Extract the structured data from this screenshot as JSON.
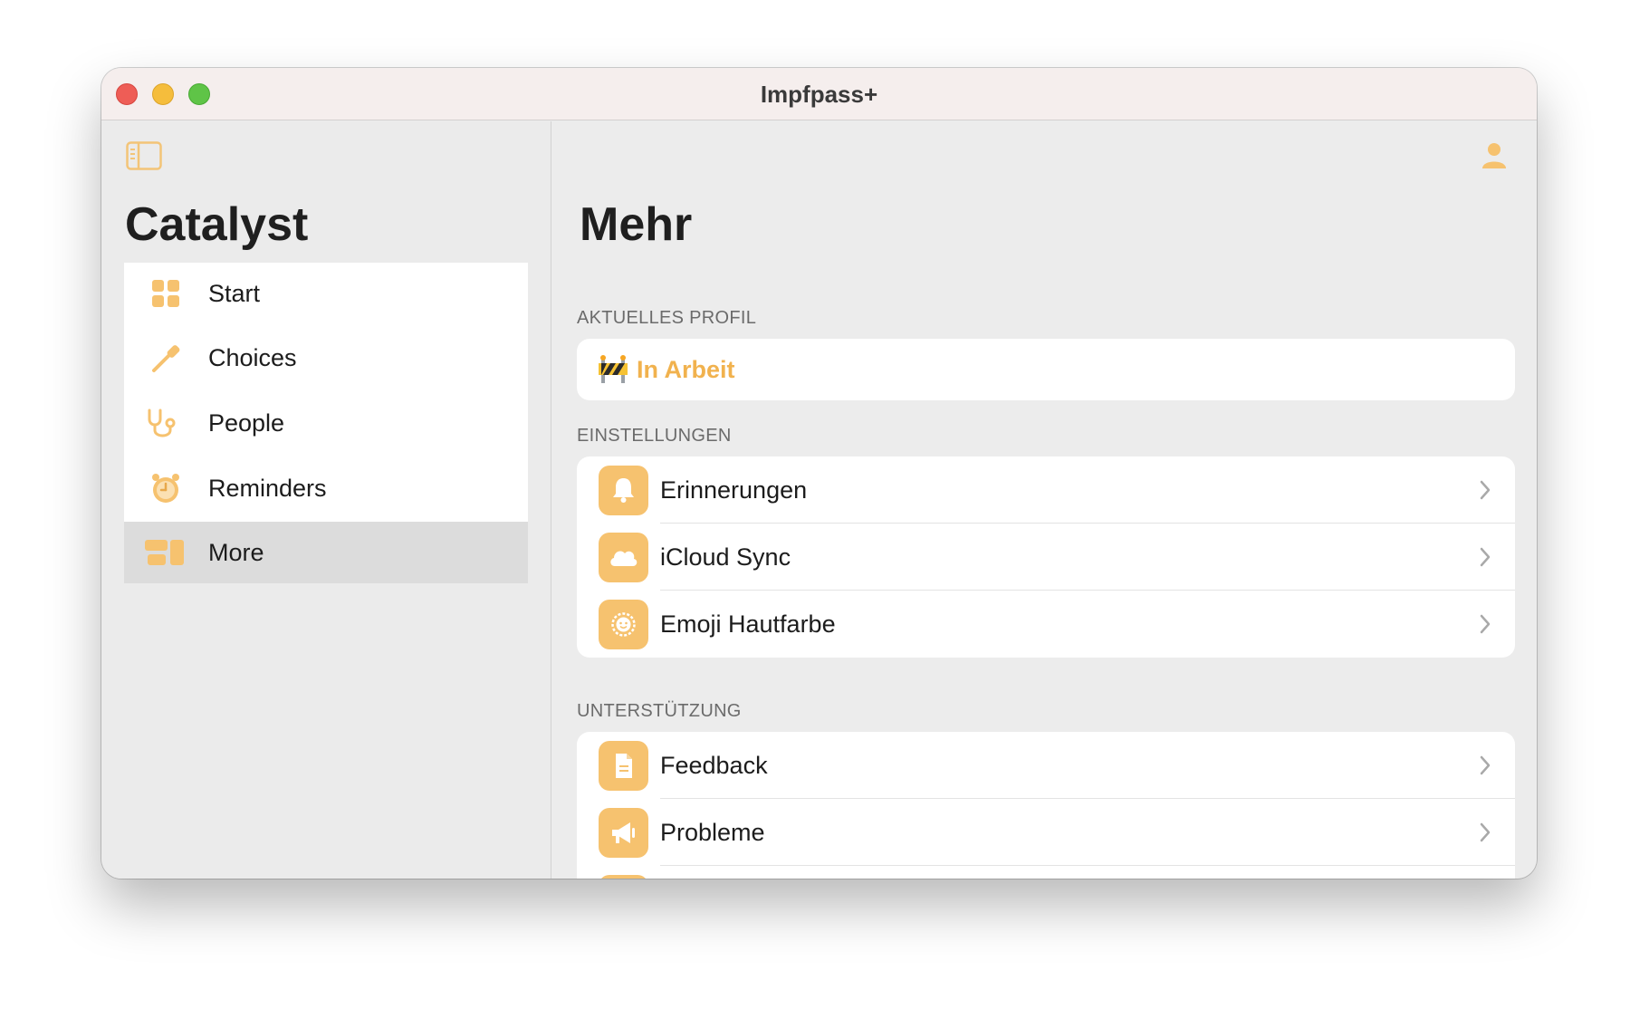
{
  "window": {
    "title": "Impfpass+"
  },
  "sidebar": {
    "title": "Catalyst",
    "items": [
      {
        "label": "Start",
        "icon": "grid-icon"
      },
      {
        "label": "Choices",
        "icon": "eyedropper-icon"
      },
      {
        "label": "People",
        "icon": "stethoscope-icon"
      },
      {
        "label": "Reminders",
        "icon": "alarm-clock-icon"
      },
      {
        "label": "More",
        "icon": "widgets-icon",
        "selected": true
      }
    ]
  },
  "main": {
    "title": "Mehr",
    "sections": [
      {
        "header": "AKTUELLES PROFIL",
        "profile": {
          "emoji": "construction-barrier-icon",
          "label": "In Arbeit"
        }
      },
      {
        "header": "EINSTELLUNGEN",
        "rows": [
          {
            "label": "Erinnerungen",
            "icon": "bell-icon"
          },
          {
            "label": "iCloud Sync",
            "icon": "cloud-icon"
          },
          {
            "label": "Emoji Hautfarbe",
            "icon": "smiley-icon"
          }
        ]
      },
      {
        "header": "UNTERSTÜTZUNG",
        "rows": [
          {
            "label": "Feedback",
            "icon": "document-icon"
          },
          {
            "label": "Probleme",
            "icon": "megaphone-icon"
          },
          {
            "label": "",
            "icon": "app-icon"
          }
        ]
      }
    ]
  },
  "colors": {
    "accent": "#f6c26f",
    "accent_text": "#f1b24e",
    "selection": "#dcdcdc"
  }
}
